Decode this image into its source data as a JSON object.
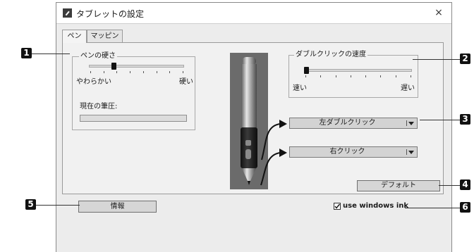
{
  "window": {
    "title": "タブレットの設定",
    "close_glyph": "×"
  },
  "tabs": [
    {
      "label": "ペン",
      "selected": true
    },
    {
      "label": "マッピング",
      "selected": false
    }
  ],
  "pen_feel": {
    "group_title": "ペンの硬さ",
    "left_label": "やわらかい",
    "right_label": "硬い",
    "slider_level": 0.25,
    "pressure_label": "現在の筆圧:",
    "pressure_level": 0
  },
  "double_click": {
    "group_title": "ダブルクリックの速度",
    "left_label": "速い",
    "right_label": "遅い",
    "slider_level": 0.0
  },
  "buttons": {
    "upper_dropdown": "左ダブルクリック",
    "lower_dropdown": "右クリック",
    "default": "デフォルト",
    "info": "情報"
  },
  "checkbox": {
    "label": "use windows ink",
    "checked": true
  },
  "callouts": [
    "1",
    "2",
    "3",
    "4",
    "5",
    "6"
  ],
  "colors": {
    "badge": "#111111",
    "pen_panel": "#6b6b6b"
  }
}
